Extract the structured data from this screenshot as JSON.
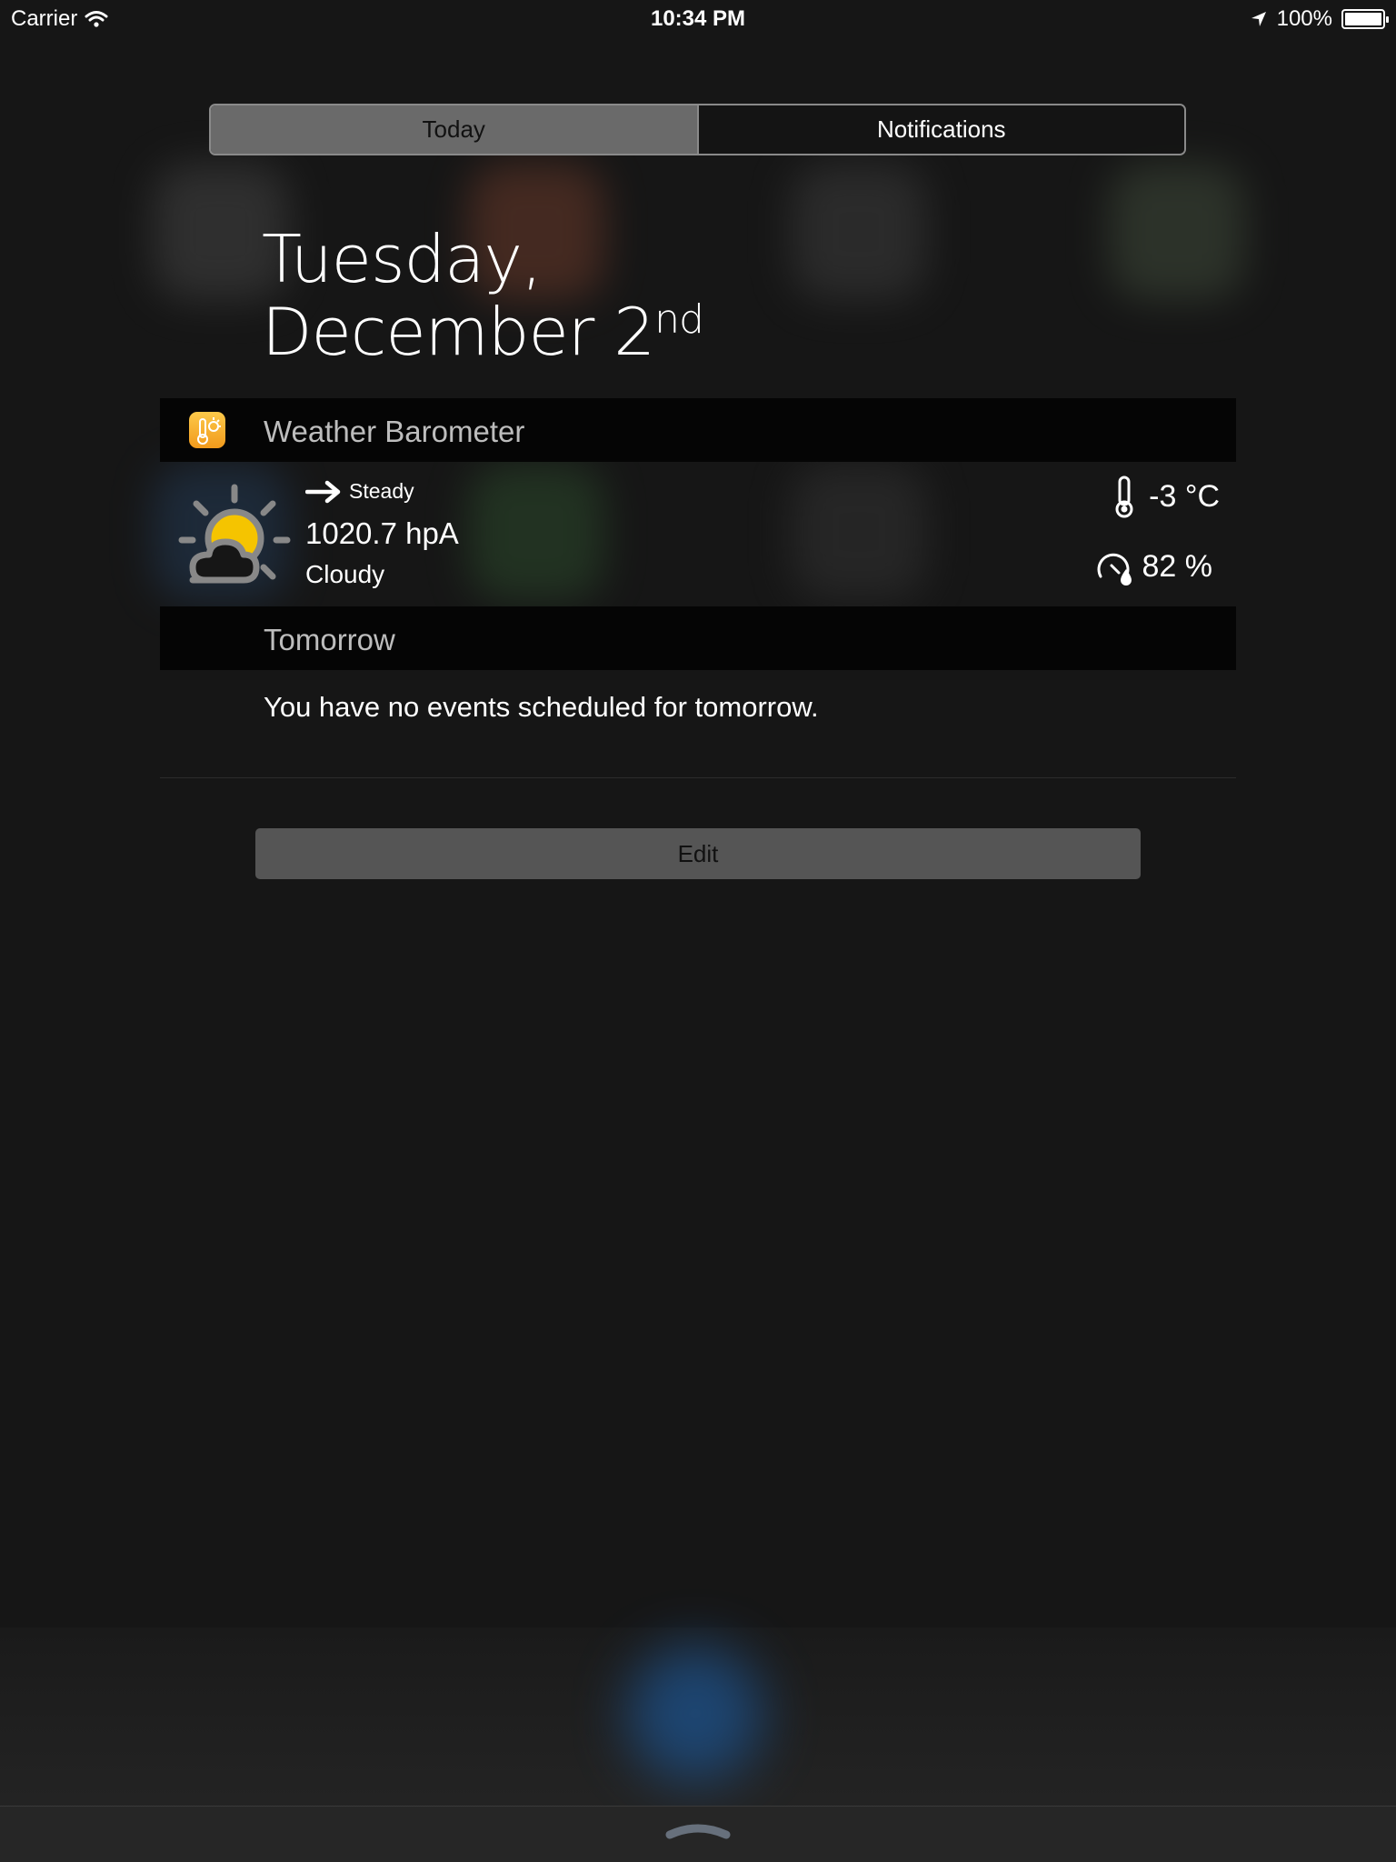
{
  "status_bar": {
    "carrier": "Carrier",
    "time": "10:34 PM",
    "battery_percent": "100%"
  },
  "tabs": [
    {
      "label": "Today",
      "selected": true
    },
    {
      "label": "Notifications",
      "selected": false
    }
  ],
  "date": {
    "line1": "Tuesday,",
    "line2": "December 2",
    "suffix": "nd"
  },
  "weather_widget": {
    "title": "Weather Barometer",
    "trend": "Steady",
    "pressure": "1020.7 hpA",
    "condition": "Cloudy",
    "temperature": "-3 °C",
    "humidity": "82 %",
    "icons": {
      "app": "barometer-app-icon",
      "weather": "partly-cloudy-icon",
      "trend": "arrow-right-icon",
      "temperature": "thermometer-icon",
      "humidity": "humidity-gauge-icon"
    }
  },
  "tomorrow_widget": {
    "title": "Tomorrow",
    "message": "You have no events scheduled for tomorrow."
  },
  "edit_button": {
    "label": "Edit"
  },
  "colors": {
    "background": "#161616",
    "header_bg": "#050505",
    "sun": "#f5c400",
    "app_icon": "#f6ad2c",
    "segment_active": "#6a6a6a",
    "edit_button": "#555555"
  }
}
